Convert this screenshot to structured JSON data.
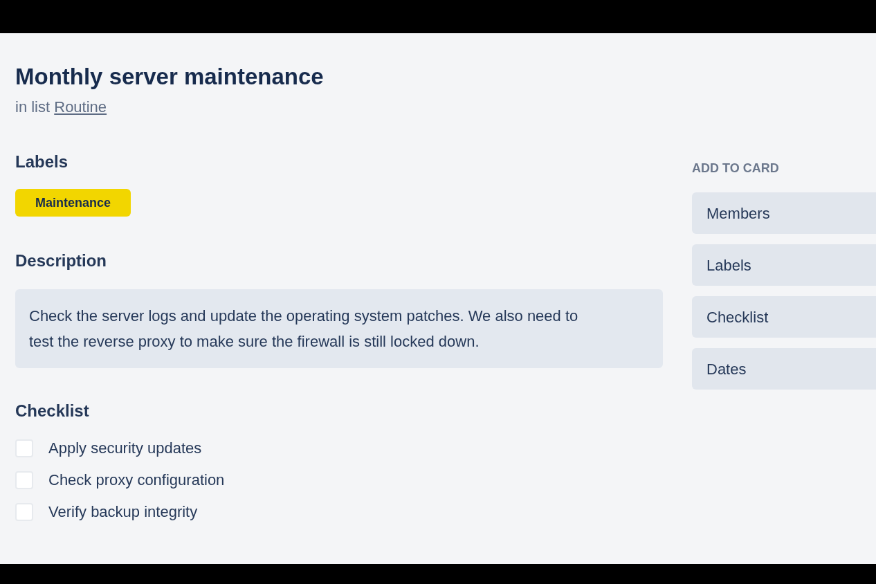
{
  "card": {
    "title": "Monthly server maintenance",
    "list_prefix": "in list",
    "list_name": "Routine"
  },
  "labels": {
    "heading": "Labels",
    "items": [
      {
        "text": "Maintenance",
        "color": "#f2d600"
      }
    ]
  },
  "description": {
    "heading": "Description",
    "text": "Check the server logs and update the operating system patches. We also need to test the reverse proxy to make sure the firewall is still locked down."
  },
  "checklist": {
    "heading": "Checklist",
    "items": [
      {
        "text": "Apply security updates",
        "checked": false
      },
      {
        "text": "Check proxy configuration",
        "checked": false
      },
      {
        "text": "Verify backup integrity",
        "checked": false
      }
    ]
  },
  "sidebar": {
    "heading": "ADD TO CARD",
    "buttons": [
      "Members",
      "Labels",
      "Checklist",
      "Dates"
    ]
  }
}
